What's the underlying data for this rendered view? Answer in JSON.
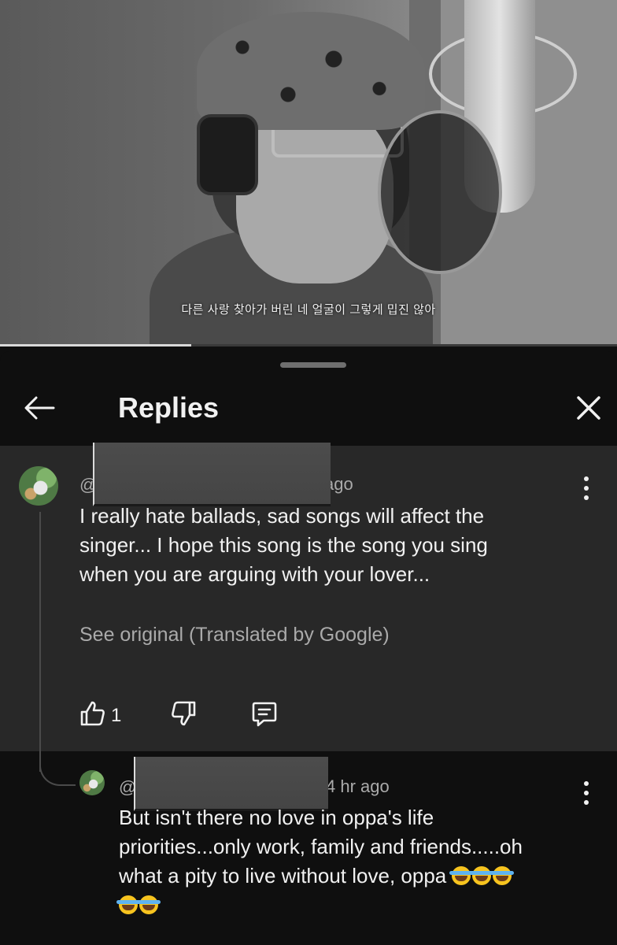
{
  "video": {
    "subtitle": "다른 사랑 찾아가 버린 네 얼굴이 그렇게 밉진 않아",
    "progress": 0.31
  },
  "header": {
    "title": "Replies"
  },
  "parent_comment": {
    "handle_prefix": "@",
    "time_suffix": "ago",
    "text_lines": [
      "I really hate ballads, sad songs will affect the",
      "singer... I hope this song is the song you sing",
      "when you are arguing with your lover..."
    ],
    "see_original": "See original (Translated by Google)",
    "like_count": "1"
  },
  "reply": {
    "handle_prefix": "@",
    "time": "4 hr ago",
    "text_lines": [
      "But isn't there no love in oppa's life",
      "priorities...only work, family and friends.....oh",
      "what a pity to live without love, oppa"
    ],
    "emoji_line1_count": 3,
    "emoji_line2_count": 2
  },
  "icons": {
    "back": "back-arrow-icon",
    "close": "close-icon",
    "more": "kebab-menu-icon",
    "like": "thumbs-up-icon",
    "dislike": "thumbs-down-icon",
    "reply": "reply-comment-icon",
    "emoji": "face-with-tears-of-joy-icon"
  }
}
